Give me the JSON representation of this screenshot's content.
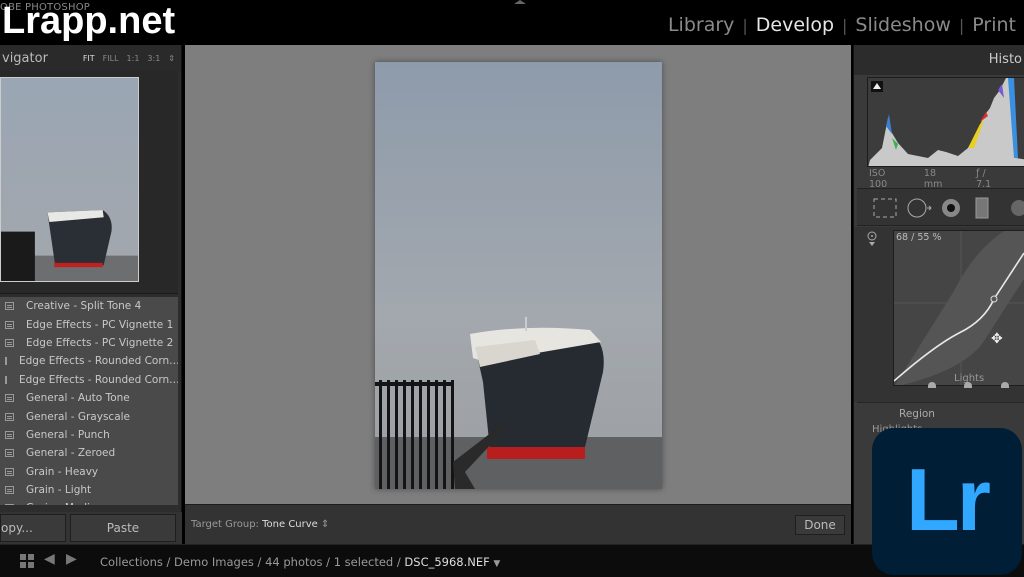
{
  "top": {
    "brand_small": "OBE PHOTOSHOP",
    "watermark": "Lrapp.net",
    "modules": [
      {
        "label": "Library",
        "active": false
      },
      {
        "label": "Develop",
        "active": true
      },
      {
        "label": "Slideshow",
        "active": false
      },
      {
        "label": "Print",
        "active": false
      }
    ]
  },
  "navigator": {
    "title": "vigator",
    "options": [
      "FIT",
      "FILL",
      "1:1",
      "3:1"
    ],
    "active_option": "FIT"
  },
  "presets": [
    "Creative - Split Tone 4",
    "Edge Effects - PC Vignette 1",
    "Edge Effects - PC Vignette 2",
    "Edge Effects - Rounded Corn…",
    "Edge Effects - Rounded Corn…",
    "General - Auto Tone",
    "General - Grayscale",
    "General - Punch",
    "General - Zeroed",
    "Grain - Heavy",
    "Grain - Light",
    "Grain - Medium"
  ],
  "left_buttons": {
    "copy": "opy...",
    "paste": "Paste"
  },
  "toolbar": {
    "target_group_label": "Target Group:",
    "target_group_value": "Tone Curve",
    "done": "Done"
  },
  "histogram": {
    "title": "Histo",
    "iso": "ISO 100",
    "focal": "18 mm",
    "aperture": "ƒ / 7.1"
  },
  "tone_curve": {
    "readout": "68 / 55 %",
    "region_hover": "Lights",
    "region_title": "Region",
    "region_sub": "Highlights"
  },
  "filmstrip": {
    "path": "Collections / Demo Images / 44 photos / 1 selected / ",
    "file": "DSC_5968.NEF"
  },
  "logo": {
    "text": "Lr",
    "bg": "#001e36",
    "fg": "#31a8ff"
  }
}
